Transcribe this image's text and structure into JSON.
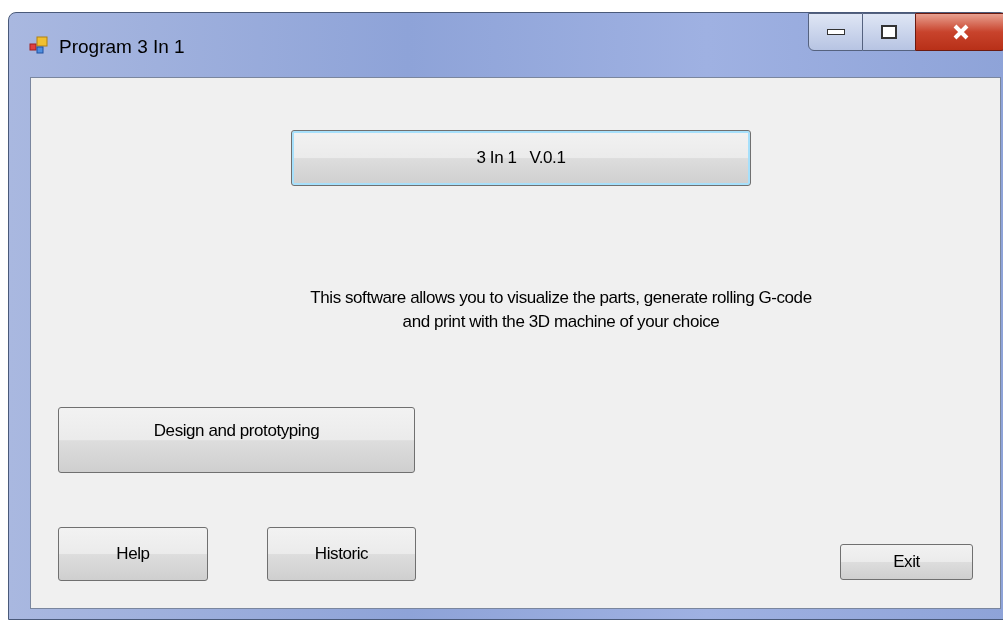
{
  "window": {
    "title": "Program 3 In 1"
  },
  "version_button": {
    "label": "3 In 1   V.0.1",
    "focused": true
  },
  "description": [
    "This software allows you to visualize the parts, generate rolling G-code",
    "and print with the 3D machine of your choice"
  ],
  "design_button": {
    "label": "Design and prototyping"
  },
  "buttons": [
    {
      "label": "Help"
    },
    {
      "label": "Historic"
    },
    {
      "label": "Exit"
    }
  ]
}
